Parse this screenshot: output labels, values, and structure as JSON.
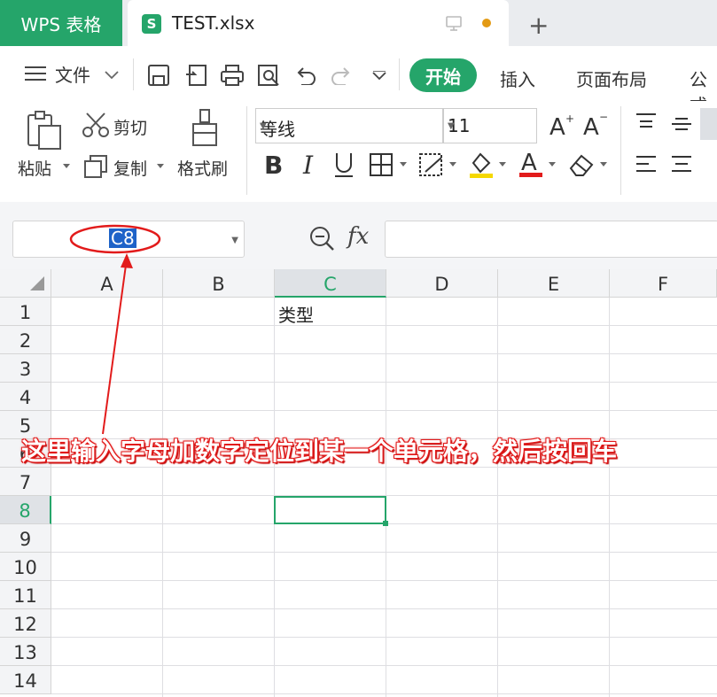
{
  "titlebar": {
    "app_tab": "WPS 表格",
    "file_tab": "TEST.xlsx",
    "file_icon_letter": "S",
    "new_tab_symbol": "+"
  },
  "toolbar": {
    "file_menu": "文件",
    "start_tab": "开始",
    "insert_tab": "插入",
    "page_layout_tab": "页面布局",
    "formula_tab": "公式"
  },
  "ribbon": {
    "paste_label": "粘贴",
    "cut_label": "剪切",
    "copy_label": "复制",
    "format_painter_label": "格式刷",
    "font_name": "等线",
    "font_size": "11"
  },
  "formula_bar": {
    "name_box_value": "C8",
    "fx_label": "fx",
    "formula_value": ""
  },
  "grid": {
    "columns": [
      "A",
      "B",
      "C",
      "D",
      "E",
      "F"
    ],
    "rows": [
      "1",
      "2",
      "3",
      "4",
      "5",
      "6",
      "7",
      "8",
      "9",
      "10",
      "11",
      "12",
      "13",
      "14"
    ],
    "active_column": "C",
    "active_row": "8",
    "cells": {
      "C1": "类型"
    }
  },
  "annotation": {
    "text": "这里输入字母加数字定位到某一个单元格，然后按回车",
    "color": "#e21b1b"
  },
  "colors": {
    "accent": "#25a56a",
    "selection": "#1e63c8",
    "annotation": "#e21b1b"
  }
}
